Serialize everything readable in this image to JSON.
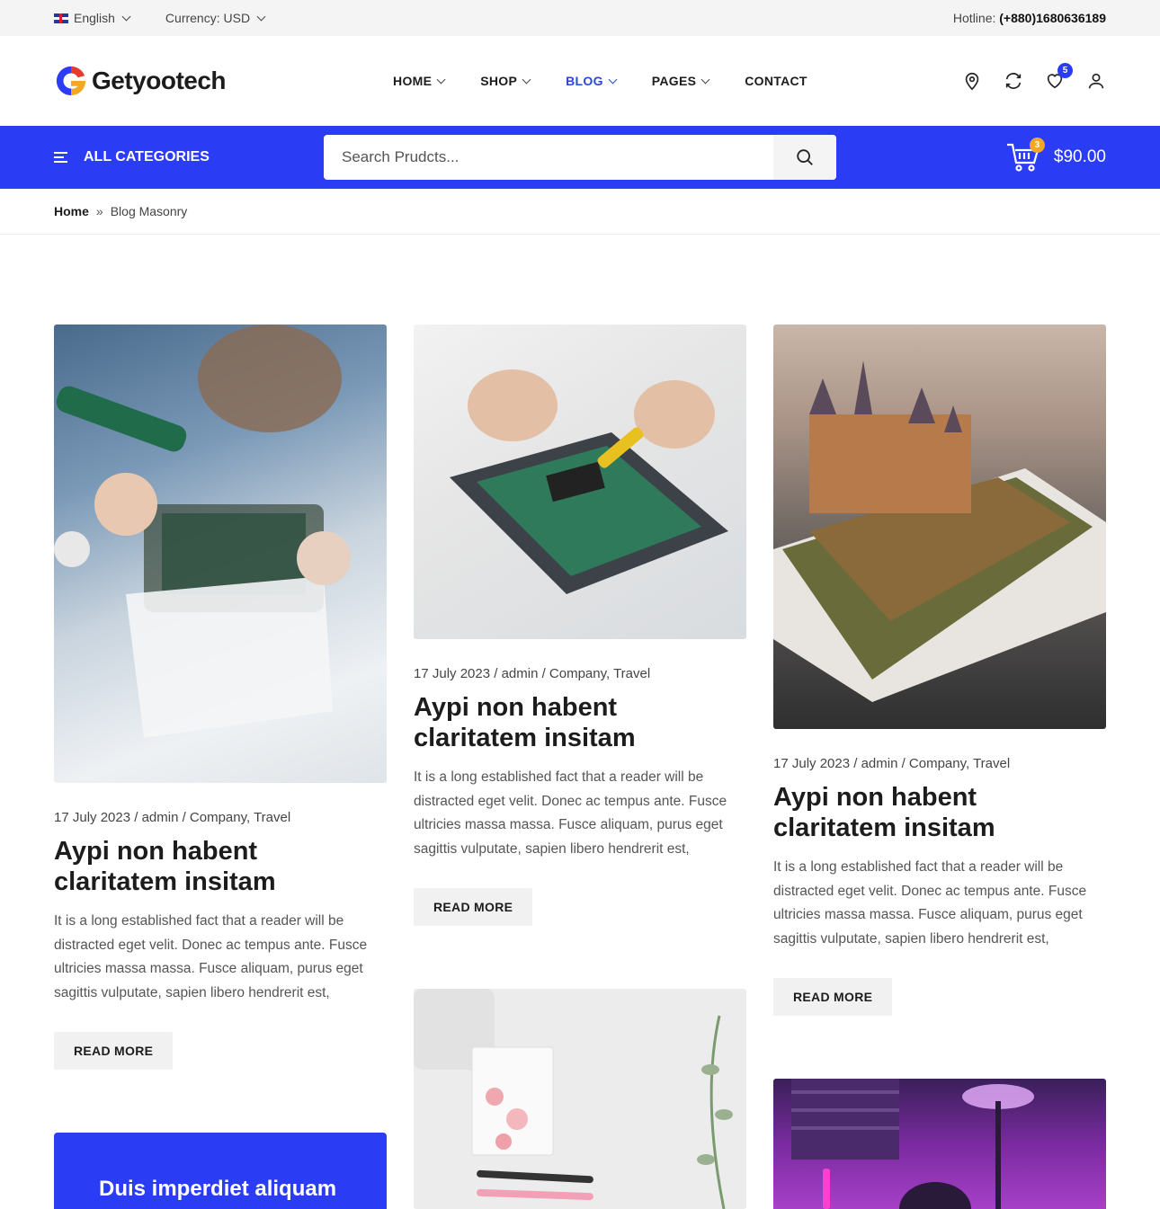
{
  "topbar": {
    "language": "English",
    "currency": "Currency: USD",
    "hotline_label": "Hotline:",
    "hotline_number": "(+880)1680636189"
  },
  "header": {
    "logo_text": "Getyootech",
    "nav": [
      {
        "label": "HOME",
        "has_dropdown": true
      },
      {
        "label": "SHOP",
        "has_dropdown": true
      },
      {
        "label": "BLOG",
        "has_dropdown": true,
        "active": true
      },
      {
        "label": "PAGES",
        "has_dropdown": true
      },
      {
        "label": "CONTACT",
        "has_dropdown": false
      }
    ],
    "icons": [
      "location-icon",
      "compare-icon",
      "wishlist-icon",
      "user-icon"
    ],
    "wishlist_count": "5"
  },
  "bluebar": {
    "all_categories": "ALL CATEGORIES",
    "search_placeholder": "Search Prudcts...",
    "cart_count": "3",
    "cart_total": "$90.00"
  },
  "breadcrumb": {
    "home": "Home",
    "current": "Blog Masonry"
  },
  "posts": [
    {
      "meta": "17 July 2023 / admin / Company, Travel",
      "title": "Aypi non habent claritatem insitam",
      "excerpt": "It is a long established fact that a reader will be distracted eget velit. Donec ac tempus ante. Fusce ultricies massa massa. Fusce aliquam, purus eget sagittis vulputate, sapien libero hendrerit est,",
      "cta": "READ MORE"
    },
    {
      "meta": "17 July 2023 / admin / Company, Travel",
      "title": "Aypi non habent claritatem insitam",
      "excerpt": "It is a long established fact that a reader will be distracted eget velit. Donec ac tempus ante. Fusce ultricies massa massa. Fusce aliquam, purus eget sagittis vulputate, sapien libero hendrerit est,",
      "cta": "READ MORE"
    },
    {
      "meta": "17 July 2023 / admin / Company, Travel",
      "title": "Aypi non habent claritatem insitam",
      "excerpt": "It is a long established fact that a reader will be distracted eget velit. Donec ac tempus ante. Fusce ultricies massa massa. Fusce aliquam, purus eget sagittis vulputate, sapien libero hendrerit est,",
      "cta": "READ MORE"
    }
  ],
  "promo": {
    "title": "Duis imperdiet aliquam"
  },
  "colors": {
    "brand_blue": "#2b3cf5",
    "nav_active": "#2b47d6",
    "badge_orange": "#f5a623"
  }
}
